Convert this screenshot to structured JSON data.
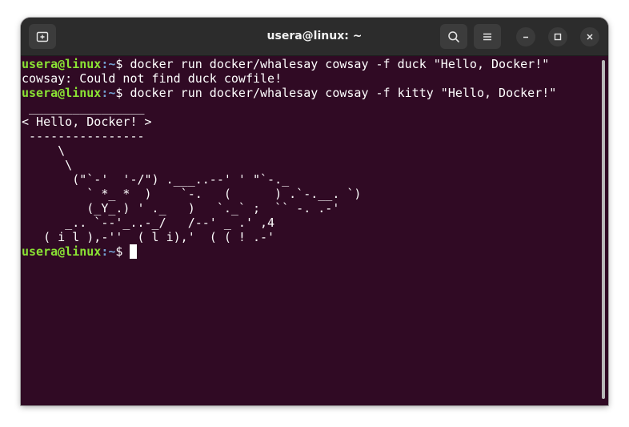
{
  "window": {
    "title": "usera@linux: ~"
  },
  "titlebar": {
    "new_tab_icon": "new-tab-icon",
    "search_icon": "search-icon",
    "menu_icon": "hamburger-menu-icon",
    "minimize_icon": "minimize-icon",
    "maximize_icon": "maximize-icon",
    "close_icon": "close-icon"
  },
  "prompt": {
    "user_host": "usera@linux",
    "path": ":~",
    "symbol": "$ "
  },
  "terminal": {
    "lines": [
      {
        "type": "prompt",
        "command": "docker run docker/whalesay cowsay -f duck \"Hello, Docker!\""
      },
      {
        "type": "output",
        "text": "cowsay: Could not find duck cowfile!"
      },
      {
        "type": "prompt",
        "command": "docker run docker/whalesay cowsay -f kitty \"Hello, Docker!\""
      },
      {
        "type": "output",
        "text": " ________________"
      },
      {
        "type": "output",
        "text": "< Hello, Docker! >"
      },
      {
        "type": "output",
        "text": " ----------------"
      },
      {
        "type": "output",
        "text": "     \\"
      },
      {
        "type": "output",
        "text": "      \\"
      },
      {
        "type": "output",
        "text": "       (\"`-'  '-/\") .___..--' ' \"`-._"
      },
      {
        "type": "output",
        "text": "         ` *_ *  )    `-.   (      ) .`-.__. `)"
      },
      {
        "type": "output",
        "text": "         (_Y_.) ' ._   )   `._` ;  `` -. .-'"
      },
      {
        "type": "output",
        "text": "      _.. `--'_..-_/   /--' _ .' ,4"
      },
      {
        "type": "output",
        "text": "   ( i l ),-''  ( l i),'  ( ( ! .-'"
      },
      {
        "type": "prompt_active",
        "command": ""
      }
    ]
  },
  "colors": {
    "background": "#300a24",
    "prompt_user": "#8ae234",
    "prompt_path": "#729fcf",
    "text": "#ffffff",
    "titlebar": "#2c2c2c"
  }
}
